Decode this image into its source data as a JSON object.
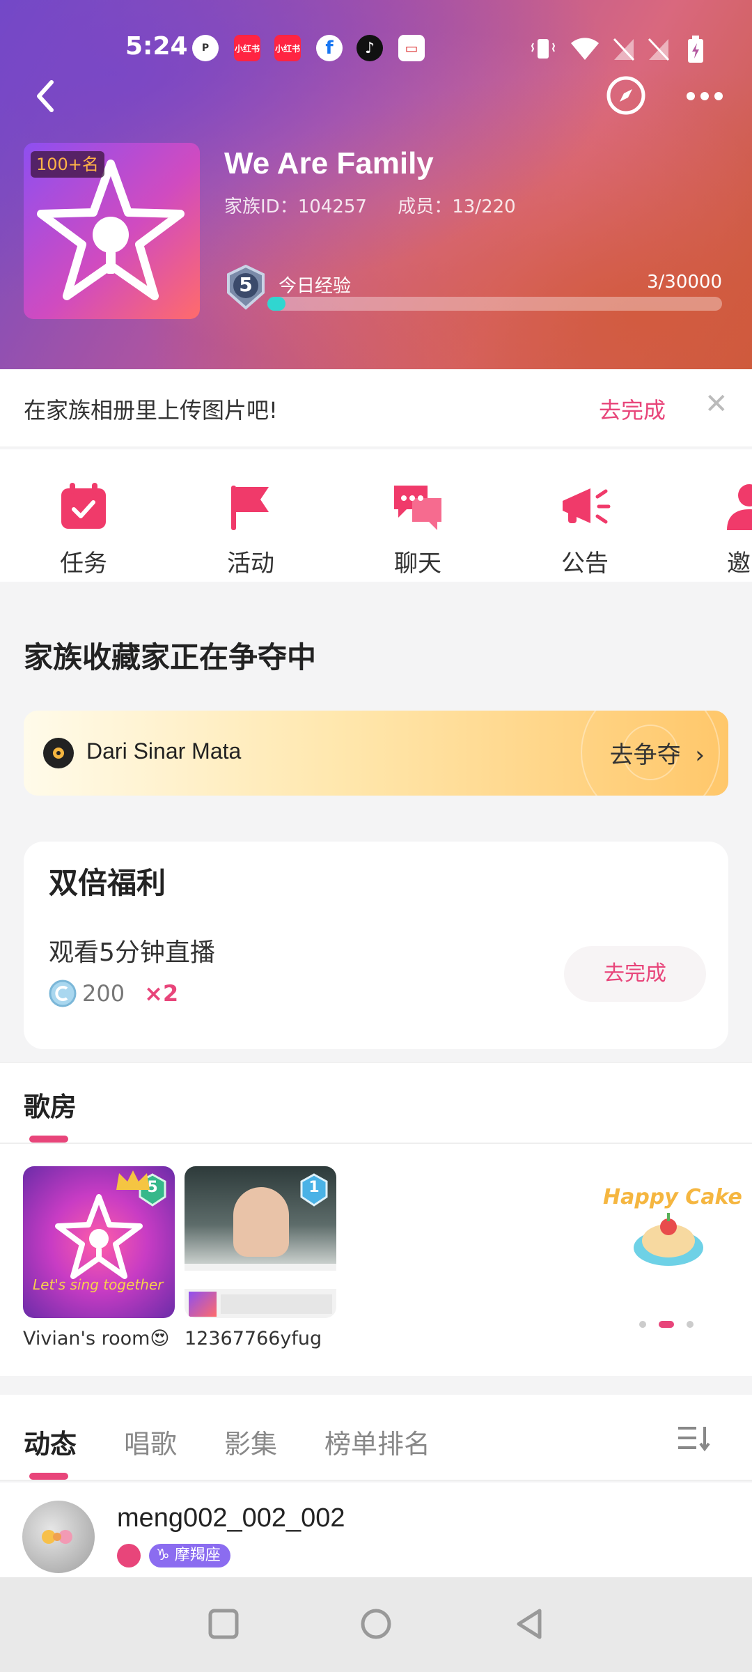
{
  "status_bar": {
    "time": "5:24",
    "notifications": [
      "app-icon",
      "xiaohongshu-icon",
      "xiaohongshu-icon",
      "facebook-icon",
      "tiktok-icon",
      "mail-icon"
    ],
    "notification_labels": [
      "小红书",
      "小红书"
    ]
  },
  "family": {
    "avatar_badge": "100+名",
    "name": "We Are Family",
    "id_text": "家族ID：104257",
    "members_text": "成员：13/220",
    "level": "5",
    "exp_label": "今日经验",
    "exp_value": "3/30000",
    "exp_progress": 0.04
  },
  "notice": {
    "text": "在家族相册里上传图片吧!",
    "action": "去完成"
  },
  "features": [
    {
      "label": "任务",
      "icon": "calendar-check-icon"
    },
    {
      "label": "活动",
      "icon": "flag-icon"
    },
    {
      "label": "聊天",
      "icon": "chat-bubbles-icon"
    },
    {
      "label": "公告",
      "icon": "megaphone-icon"
    },
    {
      "label": "邀",
      "icon": "user-icon"
    }
  ],
  "collector": {
    "title": "家族收藏家正在争夺中",
    "song": "Dari Sinar Mata",
    "action": "去争夺"
  },
  "benefit": {
    "title": "双倍福利",
    "task": "观看5分钟直播",
    "coins": "200",
    "multiplier": "×2",
    "action": "去完成"
  },
  "rooms": {
    "title": "歌房",
    "items": [
      {
        "name": "Vivian's room😍",
        "level": "5",
        "thumb_caption": "Let's sing together"
      },
      {
        "name": "12367766yfug",
        "level": "1"
      }
    ],
    "promo_text": "Happy Cake"
  },
  "tabs": [
    "动态",
    "唱歌",
    "影集",
    "榜单排名"
  ],
  "feed": {
    "username": "meng002_002_002",
    "zodiac": "摩羯座"
  },
  "colors": {
    "accent": "#e8457a",
    "progress": "#30d6d0",
    "zodiac_tag": "#8b6cf0"
  }
}
